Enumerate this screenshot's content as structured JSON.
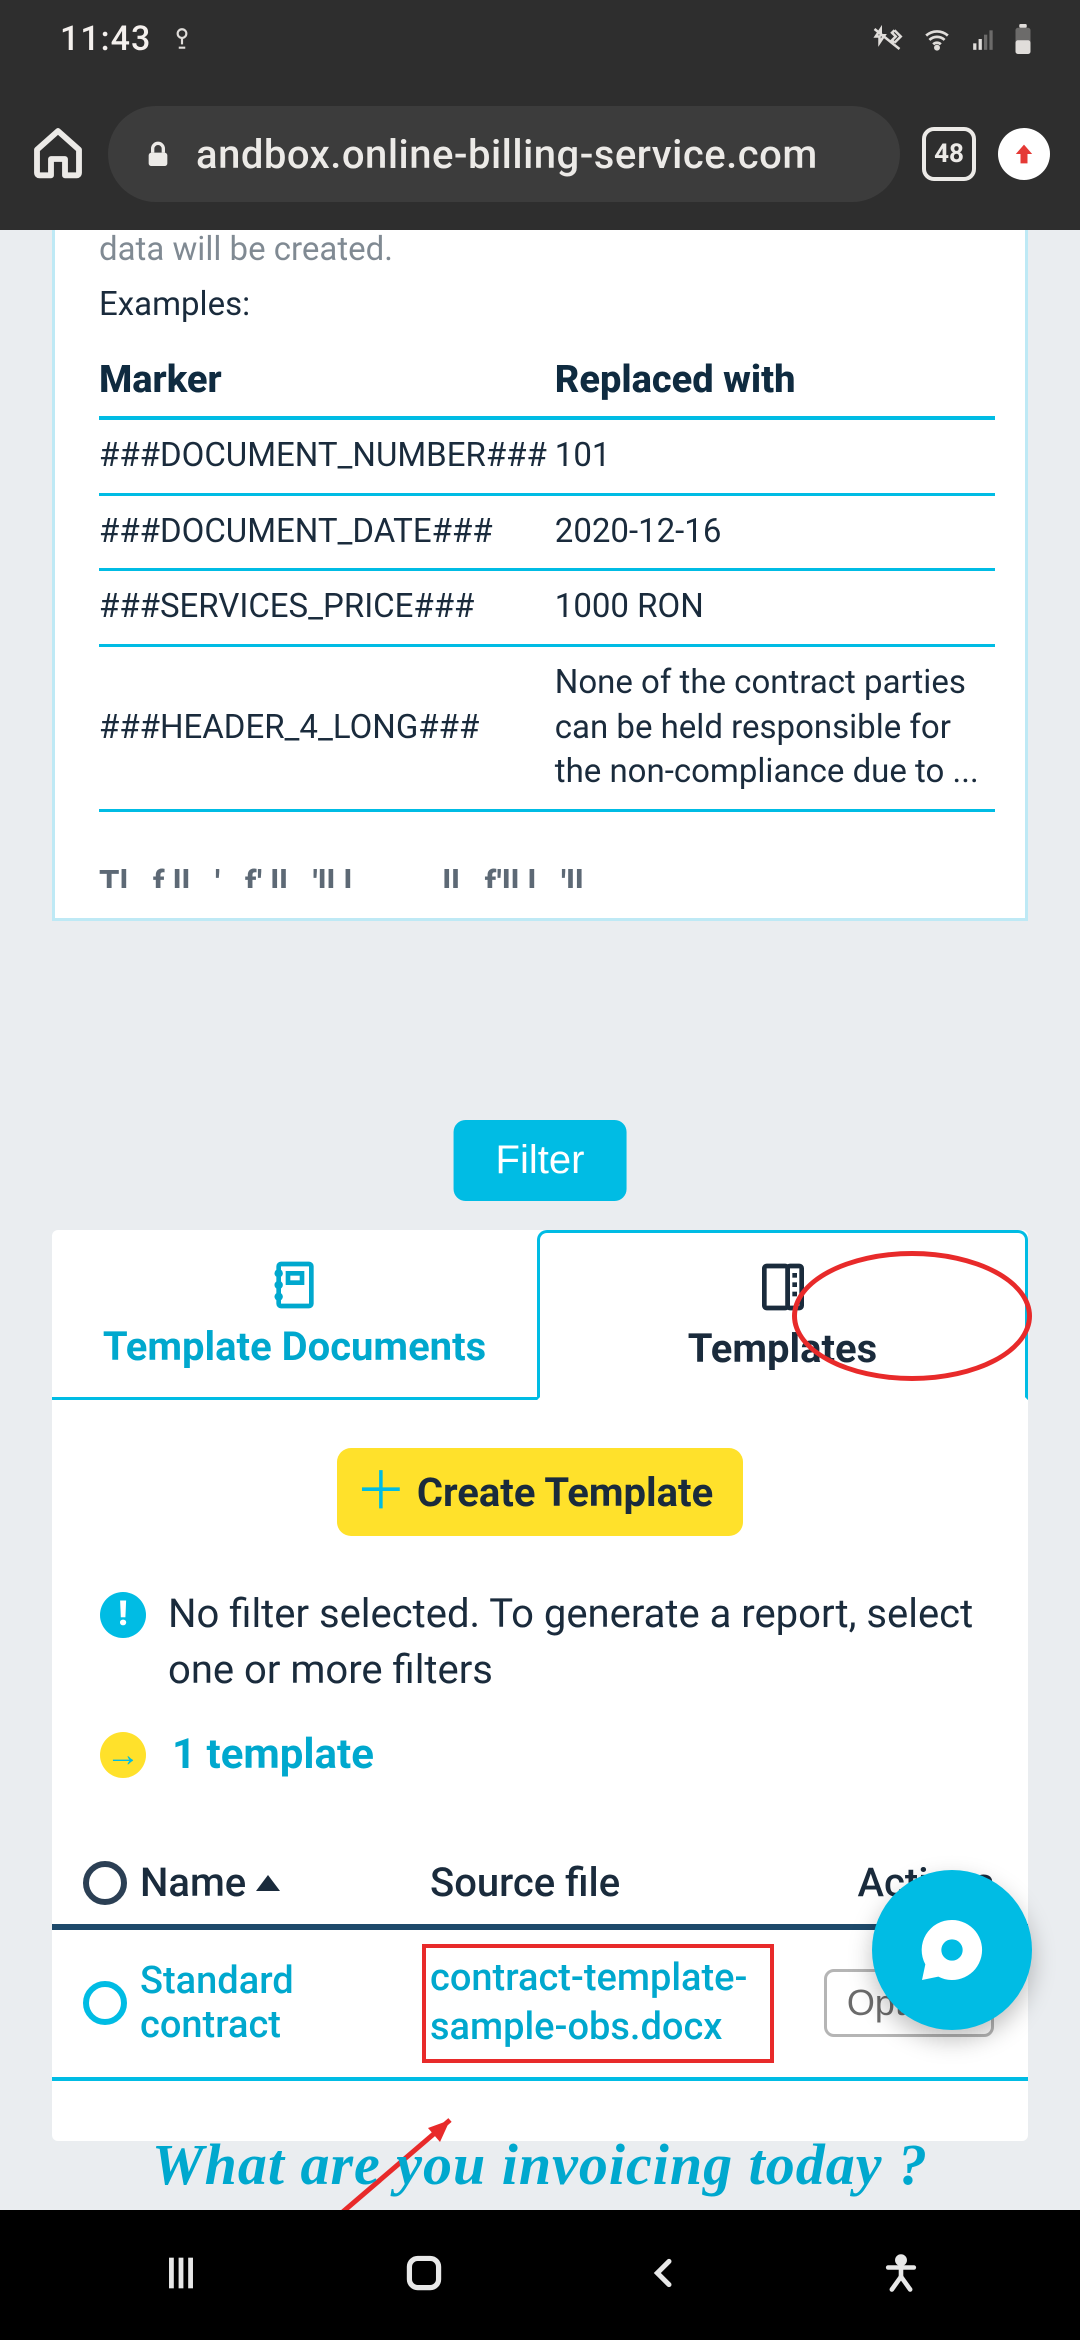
{
  "statusbar": {
    "time": "11:43"
  },
  "browser": {
    "url": "andbox.online-billing-service.com",
    "tab_count": "48"
  },
  "info": {
    "cut_line": "data will be created.",
    "examples_label": "Examples:",
    "header_marker": "Marker",
    "header_replaced": "Replaced with",
    "rows": [
      {
        "marker": "###DOCUMENT_NUMBER###",
        "value": "101"
      },
      {
        "marker": "###DOCUMENT_DATE###",
        "value": "2020-12-16"
      },
      {
        "marker": "###SERVICES_PRICE###",
        "value": "1000 RON"
      },
      {
        "marker": "###HEADER_4_LONG###",
        "value": "None of the contract parties can be held responsible for the non-compliance due to ..."
      }
    ],
    "cutoff_hint": "The following fields will be automatically filled with the"
  },
  "filter_label": "Filter",
  "tabs": {
    "template_documents": "Template Documents",
    "templates": "Templates"
  },
  "create_label": "Create Template",
  "alert_text": "No filter selected. To generate a report, select one or more filters",
  "count_text": "1 template",
  "table": {
    "name_header": "Name",
    "source_header": "Source file",
    "actions_header": "Actions",
    "row": {
      "name": "Standard contract",
      "source": "contract-template-sample-obs.docx",
      "options": "Options"
    }
  },
  "tagline": "What are you invoicing today ?"
}
